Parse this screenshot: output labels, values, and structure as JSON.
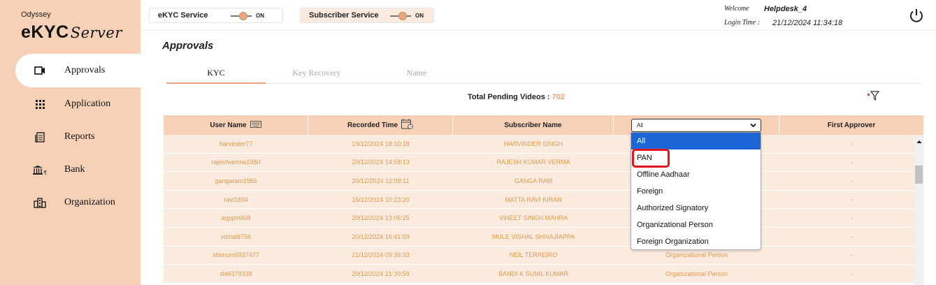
{
  "brand": {
    "top": "Odyssey",
    "main": "eKYC",
    "sub": "Server"
  },
  "sidebar": {
    "items": [
      {
        "label": "Approvals",
        "icon": "video-icon"
      },
      {
        "label": "Application",
        "icon": "grid-icon"
      },
      {
        "label": "Reports",
        "icon": "report-icon"
      },
      {
        "label": "Bank",
        "icon": "bank-icon"
      },
      {
        "label": "Organization",
        "icon": "building-icon"
      }
    ]
  },
  "topbar": {
    "ekyc_service": {
      "label": "eKYC Service",
      "state": "ON"
    },
    "subscriber_service": {
      "label": "Subscriber Service",
      "state": "ON"
    },
    "welcome_label": "Welcome",
    "username": "Helpdesk_4",
    "login_time_label": "Login Time :",
    "login_time": "21/12/2024 11:34:18"
  },
  "page": {
    "title": "Approvals"
  },
  "tabs": [
    "KYC",
    "Key Recovery",
    "Name"
  ],
  "pending": {
    "label": "Total Pending Videos :",
    "count": "702"
  },
  "table": {
    "headers": {
      "username": "User Name",
      "recorded_time": "Recorded Time",
      "subscriber_name": "Subscriber Name",
      "filter_value": "All",
      "first_approver": "First Approver"
    },
    "rows": [
      {
        "user": "harvinder77",
        "time": "19/12/2024 18:10:18",
        "name": "HARVINDER SINGH",
        "type": "",
        "approver": "-"
      },
      {
        "user": "rajeshverma1980",
        "time": "20/12/2024 14:58:13",
        "name": "RAJESH KUMAR VERMA",
        "type": "",
        "approver": "-"
      },
      {
        "user": "gangaram1965",
        "time": "20/12/2024 12:08:11",
        "name": "GANGA RAM",
        "type": "",
        "approver": "-"
      },
      {
        "user": "ravi1894",
        "time": "16/12/2024 10:23:20",
        "name": "MATTA RAVI KIRAN",
        "type": "",
        "approver": "-"
      },
      {
        "user": "aqppm808",
        "time": "20/12/2024 13:06:25",
        "name": "VINEET SINGH MAHRA",
        "type": "",
        "approver": "-"
      },
      {
        "user": "vishal8756",
        "time": "20/12/2024 16:41:59",
        "name": "MULE VISHAL SHIVAJIAPPA",
        "type": "",
        "approver": "-"
      },
      {
        "user": "sbimum5937477",
        "time": "21/12/2024 09:36:33",
        "name": "NEIL TERREIRO",
        "type": "Organizational Person",
        "approver": "-"
      },
      {
        "user": "sbi6379338",
        "time": "20/12/2024 21:30:59",
        "name": "BANDI K SUNIL KUMAR",
        "type": "Organizational Person",
        "approver": "-"
      }
    ]
  },
  "dropdown": {
    "options": [
      "All",
      "PAN",
      "Offline Aadhaar",
      "Foreign",
      "Authorized Signatory",
      "Organizational Person",
      "Foreign Organization"
    ],
    "selected": "All",
    "highlighted": "PAN"
  },
  "colors": {
    "accent": "#e8a57b",
    "sidebar": "#f6d1b7",
    "row": "#fbebdf",
    "select_blue": "#1c67d5",
    "highlight_red": "#e0161b"
  }
}
